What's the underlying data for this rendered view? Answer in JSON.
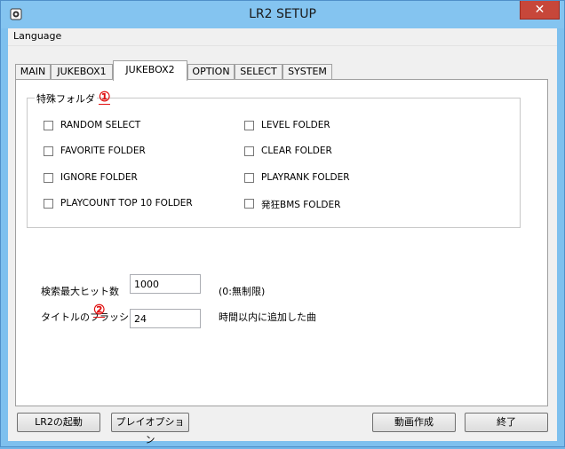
{
  "window": {
    "title": "LR2 SETUP",
    "close_label": "✕"
  },
  "menu": {
    "language": "Language"
  },
  "tabs": [
    "MAIN",
    "JUKEBOX1",
    "JUKEBOX2",
    "OPTION",
    "SELECT",
    "SYSTEM"
  ],
  "active_tab": "JUKEBOX2",
  "special_folders": {
    "label": "特殊フォルダ",
    "left": [
      "RANDOM SELECT",
      "FAVORITE FOLDER",
      "IGNORE FOLDER",
      "PLAYCOUNT TOP 10 FOLDER"
    ],
    "right": [
      "LEVEL FOLDER",
      "CLEAR FOLDER",
      "PLAYRANK FOLDER",
      "発狂BMS FOLDER"
    ]
  },
  "annotations": {
    "one": "①",
    "two": "②"
  },
  "search_max": {
    "label": "検索最大ヒット数",
    "value": "1000",
    "hint": "(0:無制限)"
  },
  "title_flash": {
    "label": "タイトルのフラッシュ",
    "value": "24",
    "hint": "時間以内に追加した曲"
  },
  "buttons": {
    "launch": "LR2の起動",
    "play_option": "プレイオプション",
    "make_movie": "動画作成",
    "exit": "終了"
  },
  "colors": {
    "title_bar": "#84c4f0",
    "close": "#c7473a",
    "annotation": "#e01010"
  }
}
